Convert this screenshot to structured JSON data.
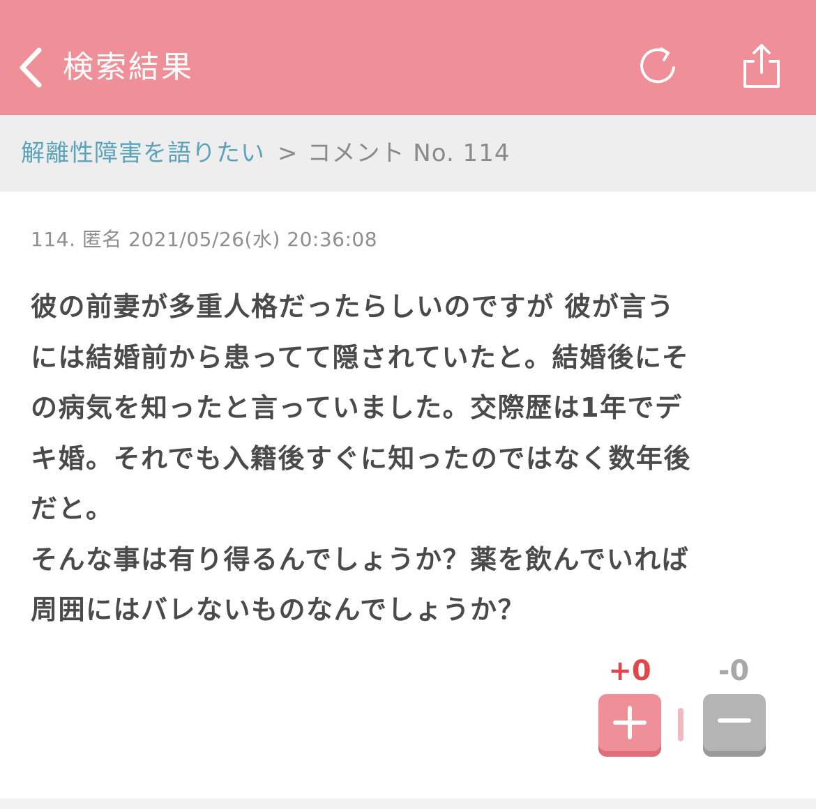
{
  "header": {
    "title": "検索結果",
    "back_icon": "chevron-left-icon",
    "refresh_icon": "refresh-icon",
    "share_icon": "share-icon",
    "background_color": "#ef9098"
  },
  "breadcrumb": {
    "topic": "解離性障害を語りたい",
    "separator": ">",
    "current": "コメント No. 114",
    "link_color": "#5aa3bb"
  },
  "comment": {
    "number": "114.",
    "author": "匿名",
    "datetime": "2021/05/26(水) 20:36:08",
    "lines": [
      "彼の前妻が多重人格だったらしいのですが 彼が言う",
      "には結婚前から患ってて隠されていたと。結婚後にそ",
      "の病気を知ったと言っていました。交際歴は1年でデ",
      "キ婚。それでも入籍後すぐに知ったのではなく数年後",
      "だと。",
      "そんな事は有り得るんでしょうか？薬を飲んでいれば",
      "周囲にはバレないものなんでしょうか？"
    ]
  },
  "votes": {
    "plus_count": "+0",
    "minus_count": "-0",
    "plus_color": "#e0464a",
    "minus_color": "#a8a8a8",
    "plus_icon": "plus-icon",
    "minus_icon": "minus-icon"
  }
}
